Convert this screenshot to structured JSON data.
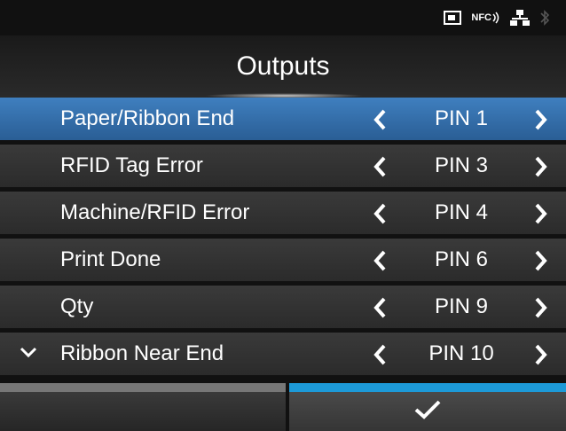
{
  "status_icons": [
    "sd-card-icon",
    "nfc-icon",
    "network-icon",
    "bluetooth-icon"
  ],
  "status": {
    "nfc_text": "NFC"
  },
  "title": "Outputs",
  "rows": [
    {
      "label": "Paper/Ribbon End",
      "value": "PIN 1",
      "selected": true
    },
    {
      "label": "RFID Tag Error",
      "value": "PIN 3"
    },
    {
      "label": "Machine/RFID Error",
      "value": "PIN 4"
    },
    {
      "label": "Print Done",
      "value": "PIN 6"
    },
    {
      "label": "Qty",
      "value": "PIN 9"
    },
    {
      "label": "Ribbon Near End",
      "value": "PIN 10",
      "has_expand_chevron": true
    }
  ],
  "footer": {
    "confirm_icon": "check-icon"
  },
  "colors": {
    "selected": "#2f6fad",
    "accent": "#1d9ad8",
    "row": "#333333"
  }
}
